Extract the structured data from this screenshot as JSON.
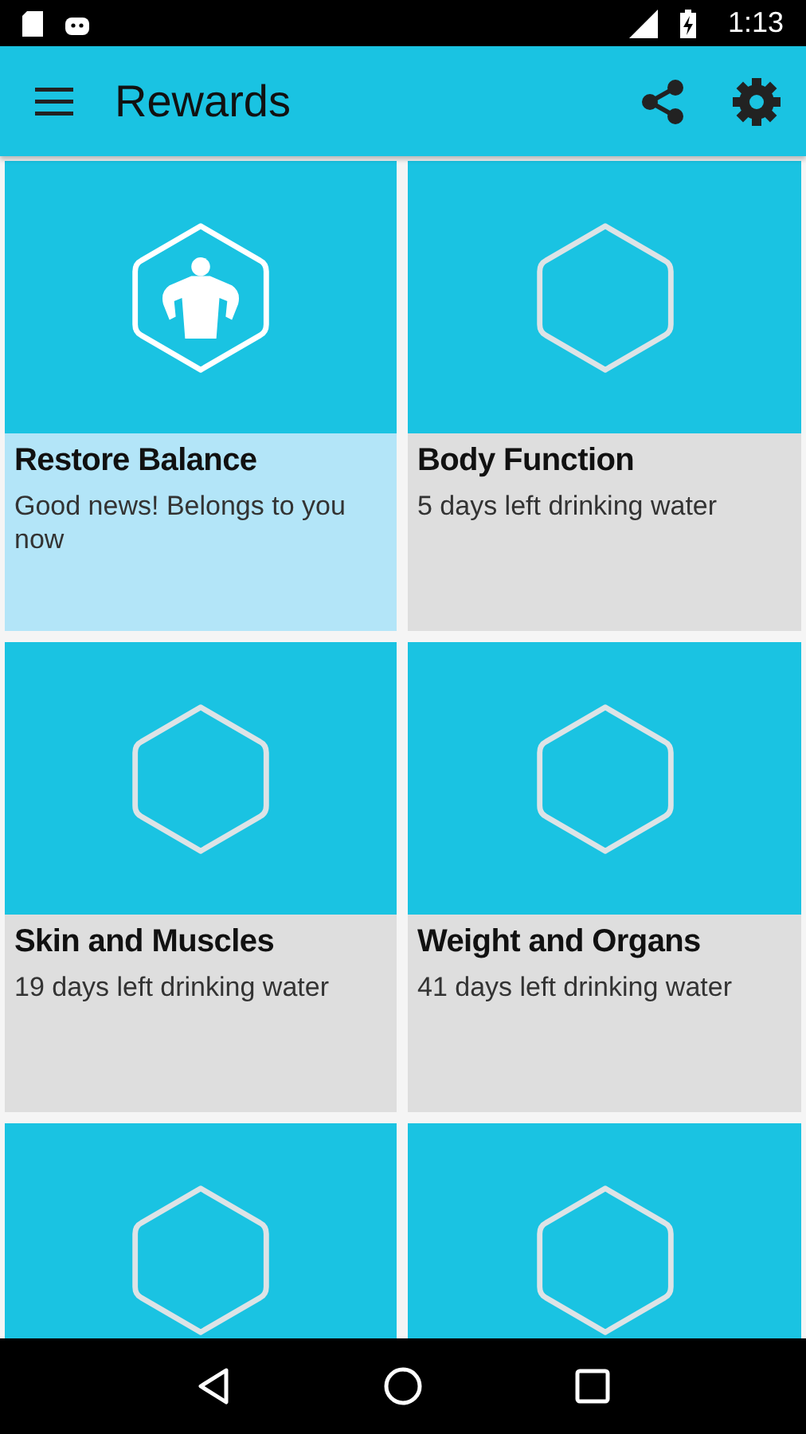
{
  "status_bar": {
    "time": "1:13"
  },
  "app_bar": {
    "title": "Rewards"
  },
  "rewards": [
    {
      "title": "Restore Balance",
      "subtitle": "Good news! Belongs to you now",
      "unlocked": true
    },
    {
      "title": "Body Function",
      "subtitle": "5 days left drinking water",
      "unlocked": false
    },
    {
      "title": "Skin and Muscles",
      "subtitle": "19 days left drinking water",
      "unlocked": false
    },
    {
      "title": "Weight and Organs",
      "subtitle": "41 days left drinking water",
      "unlocked": false
    },
    {
      "unlocked": false
    },
    {
      "unlocked": false
    }
  ]
}
